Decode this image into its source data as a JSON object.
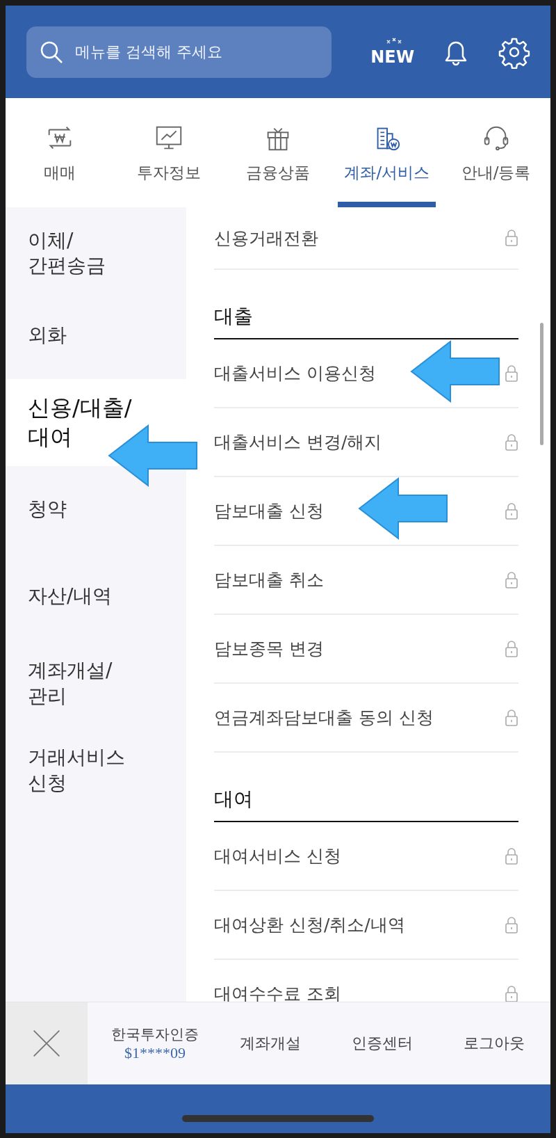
{
  "search": {
    "placeholder": "메뉴를 검색해 주세요"
  },
  "header_badge": "NEW",
  "tabs": [
    {
      "label": "매매",
      "selected": false
    },
    {
      "label": "투자정보",
      "selected": false
    },
    {
      "label": "금융상품",
      "selected": false
    },
    {
      "label": "계좌/서비스",
      "selected": true
    },
    {
      "label": "안내/등록",
      "selected": false
    }
  ],
  "sidebar": {
    "items": [
      {
        "label": "이체/\n간편송금",
        "selected": false
      },
      {
        "label": "외화",
        "selected": false
      },
      {
        "label": "신용/대출/\n대여",
        "selected": true
      },
      {
        "label": "청약",
        "selected": false
      },
      {
        "label": "자산/내역",
        "selected": false
      },
      {
        "label": "계좌개설/\n관리",
        "selected": false
      },
      {
        "label": "거래서비스\n신청",
        "selected": false
      }
    ]
  },
  "menu": [
    {
      "items": [
        {
          "label": "신용거래전환",
          "locked": true
        }
      ]
    },
    {
      "heading": "대출",
      "items": [
        {
          "label": "대출서비스 이용신청",
          "locked": true
        },
        {
          "label": "대출서비스 변경/해지",
          "locked": true
        },
        {
          "label": "담보대출 신청",
          "locked": true
        },
        {
          "label": "담보대출 취소",
          "locked": true
        },
        {
          "label": "담보종목 변경",
          "locked": true
        },
        {
          "label": "연금계좌담보대출 동의 신청",
          "locked": true
        }
      ]
    },
    {
      "heading": "대여",
      "items": [
        {
          "label": "대여서비스 신청",
          "locked": true
        },
        {
          "label": "대여상환 신청/취소/내역",
          "locked": true
        },
        {
          "label": "대여수수료 조회",
          "locked": true
        }
      ]
    }
  ],
  "bottom_bar": {
    "cert_name": "한국투자인증",
    "cert_id": "$1****09",
    "links": [
      "계좌개설",
      "인증센터",
      "로그아웃"
    ]
  }
}
